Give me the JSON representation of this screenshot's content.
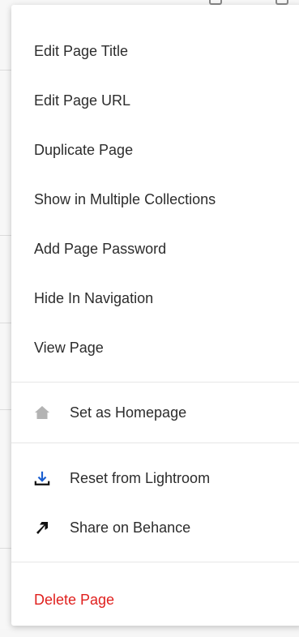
{
  "menu": {
    "items_primary": [
      {
        "label": "Edit Page Title"
      },
      {
        "label": "Edit Page URL"
      },
      {
        "label": "Duplicate Page"
      },
      {
        "label": "Show in Multiple Collections"
      },
      {
        "label": "Add Page Password"
      },
      {
        "label": "Hide In Navigation"
      },
      {
        "label": "View Page"
      }
    ],
    "homepage": {
      "label": "Set as Homepage",
      "icon": "home-icon"
    },
    "integrations": [
      {
        "label": "Reset from Lightroom",
        "icon": "download-icon"
      },
      {
        "label": "Share on Behance",
        "icon": "arrow-up-right-icon"
      }
    ],
    "delete": {
      "label": "Delete Page"
    }
  },
  "colors": {
    "danger": "#e0201e",
    "text": "#2c2c2c",
    "icon_blue": "#1a5fd0",
    "icon_gray": "#b3b3b3"
  }
}
